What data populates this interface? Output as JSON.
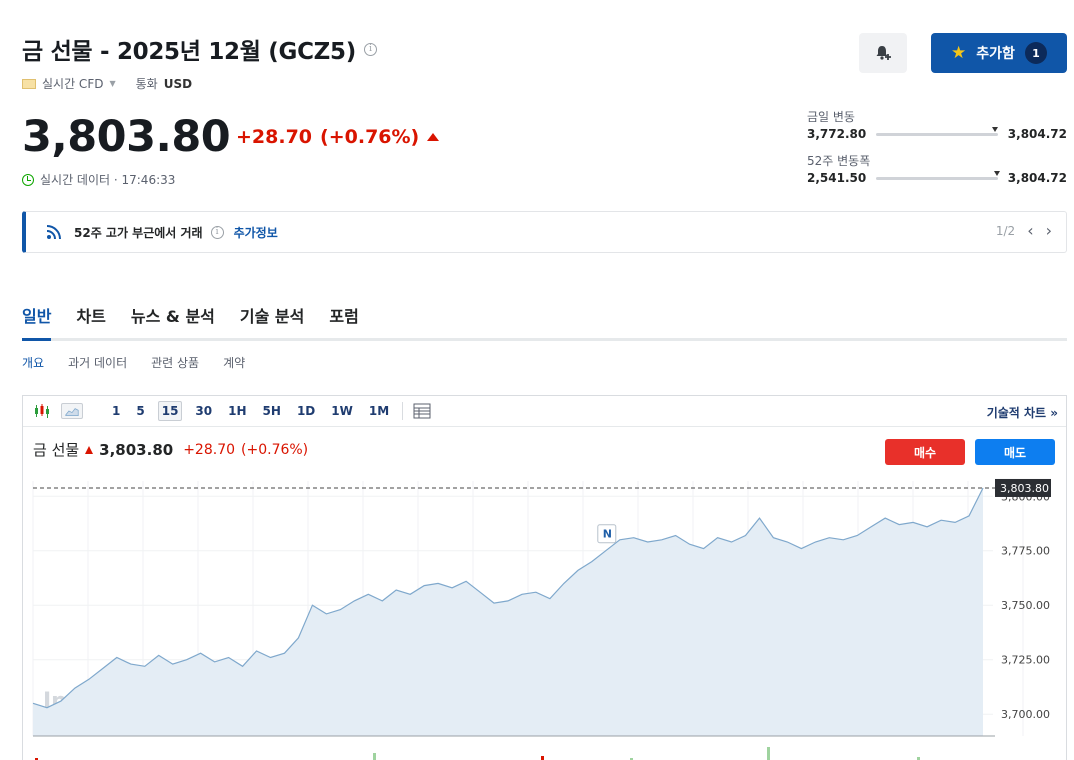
{
  "header": {
    "title": "금 선물 - 2025년 12월 (GCZ5)",
    "info_glyph": "i",
    "realtime_cfd": "실시간 CFD",
    "currency_label": "통화",
    "currency_value": "USD",
    "add_label": "추가함",
    "add_count": "1"
  },
  "quote": {
    "price": "3,803.80",
    "change": "+28.70",
    "change_pct": "(+0.76%)",
    "realtime_text": "실시간 데이터 · 17:46:33"
  },
  "ranges": {
    "day": {
      "label": "금일 변동",
      "low": "3,772.80",
      "high": "3,804.72",
      "position": 0.98
    },
    "week52": {
      "label": "52주 변동폭",
      "low": "2,541.50",
      "high": "3,804.72",
      "position": 0.99
    }
  },
  "alert": {
    "text": "52주 고가 부근에서 거래",
    "more": "추가정보",
    "pager": "1/2"
  },
  "tabs": [
    "일반",
    "차트",
    "뉴스 & 분석",
    "기술 분석",
    "포럼"
  ],
  "subtabs": [
    "개요",
    "과거 데이터",
    "관련 상품",
    "계약"
  ],
  "chart_toolbar": {
    "intervals": [
      "1",
      "5",
      "15",
      "30",
      "1H",
      "5H",
      "1D",
      "1W",
      "1M"
    ],
    "active_interval": "15",
    "tech_link": "기술적 차트 »"
  },
  "chart_header": {
    "name": "금 선물",
    "price": "3,803.80",
    "change": "+28.70",
    "change_pct": "(+0.76%)",
    "buy_label": "매수",
    "sell_label": "매도"
  },
  "colors": {
    "accent": "#1056a8",
    "down_red": "#d91400",
    "buy": "#e8302a",
    "sell": "#0d7ef0",
    "line": "#7fa8cc",
    "area": "#e4edf5"
  },
  "chart_data": {
    "type": "area",
    "watermark": "Investing.com",
    "last_price_label": "3,803.80",
    "last_price": 3803.8,
    "event_marker": {
      "label": "N",
      "index": 41
    },
    "ylim": [
      1690,
      1807
    ],
    "y_ticks": [
      3700,
      3725,
      3750,
      3775,
      3800
    ],
    "y_tick_labels": [
      "3,700.00",
      "3,725.00",
      "3,750.00",
      "3,775.00",
      "3,800.00"
    ],
    "values": [
      3705,
      3703,
      3706,
      3712,
      3716,
      3721,
      3726,
      3723,
      3722,
      3727,
      3723,
      3725,
      3728,
      3724,
      3726,
      3722,
      3729,
      3726,
      3728,
      3735,
      3750,
      3746,
      3748,
      3752,
      3755,
      3752,
      3757,
      3755,
      3759,
      3760,
      3758,
      3761,
      3756,
      3751,
      3752,
      3755,
      3756,
      3753,
      3760,
      3766,
      3770,
      3775,
      3780,
      3781,
      3779,
      3780,
      3782,
      3778,
      3776,
      3781,
      3779,
      3782,
      3790,
      3781,
      3779,
      3776,
      3779,
      3781,
      3780,
      3782,
      3786,
      3790,
      3787,
      3788,
      3786,
      3789,
      3788,
      3791,
      3803.8
    ]
  }
}
